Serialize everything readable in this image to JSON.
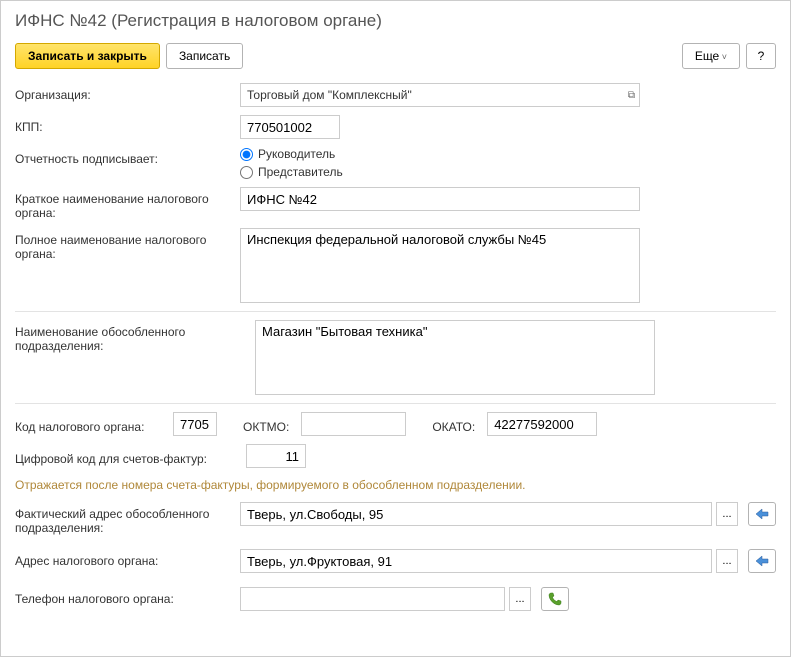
{
  "title": "ИФНС №42 (Регистрация в налоговом органе)",
  "toolbar": {
    "save_close": "Записать и закрыть",
    "save": "Записать",
    "more": "Еще",
    "help": "?"
  },
  "labels": {
    "org": "Организация:",
    "kpp": "КПП:",
    "signer": "Отчетность подписывает:",
    "short_name": "Краткое наименование налогового органа:",
    "full_name": "Полное наименование налогового органа:",
    "dept_name": "Наименование обособленного подразделения:",
    "code": "Код налогового органа:",
    "oktmo": "ОКТМО:",
    "okato": "ОКАТО:",
    "digital": "Цифровой код для счетов-фактур:",
    "actual_addr": "Фактический адрес обособленного подразделения:",
    "tax_addr": "Адрес налогового органа:",
    "tax_phone": "Телефон налогового органа:"
  },
  "values": {
    "org": "Торговый дом \"Комплексный\"",
    "kpp": "770501002",
    "short_name": "ИФНС №42",
    "full_name": "Инспекция федеральной налоговой службы №45",
    "dept_name": "Магазин \"Бытовая техника\"",
    "code": "7705",
    "oktmo": "",
    "okato": "42277592000",
    "digital": "11",
    "actual_addr": "Тверь, ул.Свободы, 95",
    "tax_addr": "Тверь, ул.Фруктовая, 91",
    "tax_phone": ""
  },
  "radio": {
    "manager": "Руководитель",
    "representative": "Представитель"
  },
  "hint": "Отражается после номера счета-фактуры, формируемого в обособленном подразделении.",
  "icons": {
    "ellipsis": "...",
    "arrow_left": "⬅",
    "phone": "📞"
  }
}
